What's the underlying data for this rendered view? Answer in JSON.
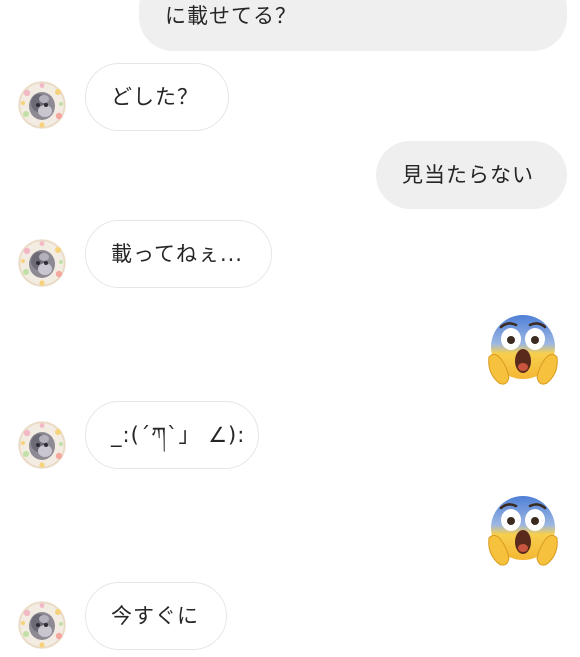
{
  "thread": {
    "messages": [
      {
        "from": "me",
        "text": "に載せてる？"
      },
      {
        "from": "them",
        "text": "どした？"
      },
      {
        "from": "me",
        "text": "見当たらない"
      },
      {
        "from": "them",
        "text": "載ってねぇ..."
      },
      {
        "from": "me",
        "emoji": "😱",
        "emoji_name": "face-screaming-in-fear"
      },
      {
        "from": "them",
        "text": "_:(´ཀ`」 ∠):"
      },
      {
        "from": "me",
        "emoji": "😱",
        "emoji_name": "face-screaming-in-fear"
      },
      {
        "from": "them",
        "text": "今すぐに"
      }
    ]
  },
  "colors": {
    "sent_bubble": "#efefef",
    "received_border": "#e6e6e6",
    "text": "#262626",
    "background": "#ffffff"
  }
}
